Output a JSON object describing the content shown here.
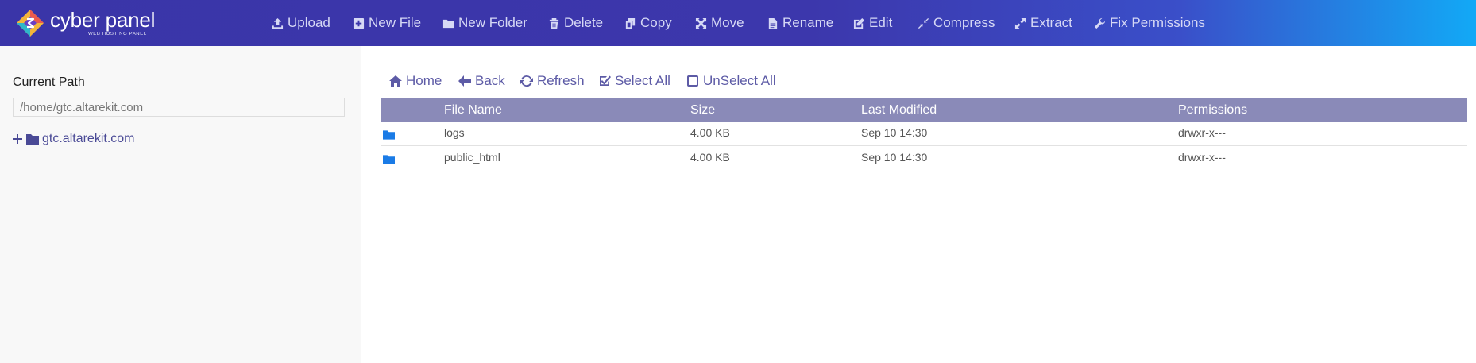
{
  "app": {
    "logo_word": "cyber panel",
    "logo_tagline": "WEB HOSTING PANEL"
  },
  "toolbar": {
    "upload": "Upload",
    "new_file": "New File",
    "new_folder": "New Folder",
    "delete": "Delete",
    "copy": "Copy",
    "move": "Move",
    "rename": "Rename",
    "edit": "Edit",
    "compress": "Compress",
    "extract": "Extract",
    "fix_permissions": "Fix Permissions"
  },
  "sidebar": {
    "current_path_label": "Current Path",
    "current_path_value": "/home/gtc.altarekit.com",
    "tree_root": "gtc.altarekit.com"
  },
  "file_nav": {
    "home": "Home",
    "back": "Back",
    "refresh": "Refresh",
    "select_all": "Select All",
    "unselect_all": "UnSelect All"
  },
  "table": {
    "headers": {
      "name": "File Name",
      "size": "Size",
      "modified": "Last Modified",
      "permissions": "Permissions"
    },
    "rows": [
      {
        "name": "logs",
        "size": "4.00 KB",
        "modified": "Sep 10 14:30",
        "permissions": "drwxr-x---"
      },
      {
        "name": "public_html",
        "size": "4.00 KB",
        "modified": "Sep 10 14:30",
        "permissions": "drwxr-x---"
      }
    ]
  },
  "colors": {
    "topbar_start": "#3a35a8",
    "topbar_end": "#12a9f6",
    "table_header": "#8a8ab8",
    "folder_icon": "#1a7be6",
    "link": "#5d5ba6"
  }
}
